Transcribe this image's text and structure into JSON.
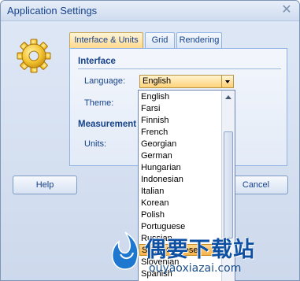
{
  "window": {
    "title": "Application Settings",
    "close_glyph": "✕"
  },
  "icons": {
    "settings": "gear-icon",
    "close": "close-icon",
    "combo_arrow": "chevron-down-icon",
    "scroll_up": "chevron-up-icon"
  },
  "tabs": [
    {
      "label": "Interface & Units",
      "active": true
    },
    {
      "label": "Grid",
      "active": false
    },
    {
      "label": "Rendering",
      "active": false
    }
  ],
  "interface": {
    "section_title": "Interface",
    "language_label": "Language:",
    "language_value": "English",
    "theme_label": "Theme:"
  },
  "measurement": {
    "section_title": "Measurement",
    "units_label": "Units:"
  },
  "buttons": {
    "help": "Help",
    "cancel": "Cancel"
  },
  "language_list": {
    "items": [
      "English",
      "Farsi",
      "Finnish",
      "French",
      "Georgian",
      "German",
      "Hungarian",
      "Indonesian",
      "Italian",
      "Korean",
      "Polish",
      "Portuguese",
      "Russian",
      "Simp. Chinese",
      "Slovenian",
      "Spanish"
    ],
    "highlighted": "Simp. Chinese"
  },
  "watermark": {
    "text": "偶要下载站",
    "url": "ouyaoxiazai.com"
  },
  "colors": {
    "accent_orange": "#ffd27a",
    "text_blue": "#15428b",
    "frame_blue": "#8db2e3"
  }
}
